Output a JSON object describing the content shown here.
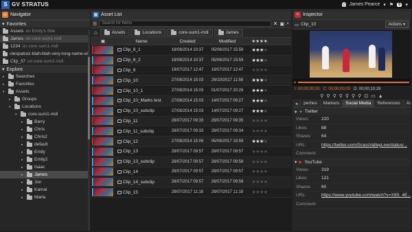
{
  "app": {
    "title": "GV STRATUS",
    "user": "James Pearce",
    "notifications": "0"
  },
  "navigator": {
    "title": "Navigator",
    "favorites_label": "Favorites",
    "favorites": [
      {
        "name": "Assets",
        "loc": " on Emily's Site"
      },
      {
        "name": "James",
        "loc": " on core-sum1-mdi"
      },
      {
        "name": "1234",
        "loc": " on core-sum1-mdi"
      },
      {
        "name": "cleopatra1-blah-blah-very-long-name-el",
        "loc": ""
      },
      {
        "name": "Clip_37",
        "loc": " on core-sum1-mdi"
      }
    ],
    "explore_label": "Explore",
    "tree": [
      {
        "label": "Searches",
        "indent": 0,
        "arrow": "▸",
        "folder": true
      },
      {
        "label": "Favorites",
        "indent": 0,
        "arrow": "▸",
        "folder": true
      },
      {
        "label": "Assets",
        "indent": 0,
        "arrow": "▾",
        "folder": true
      },
      {
        "label": "Groups",
        "indent": 1,
        "arrow": "▸",
        "folder": true
      },
      {
        "label": "Locations",
        "indent": 1,
        "arrow": "▾",
        "folder": true
      },
      {
        "label": "core-sum1-mdi",
        "indent": 2,
        "arrow": "▾",
        "folder": true
      },
      {
        "label": "Barry",
        "indent": 3,
        "arrow": "▸",
        "folder": true
      },
      {
        "label": "Chris",
        "indent": 3,
        "arrow": "▸",
        "folder": true
      },
      {
        "label": "Chris2",
        "indent": 3,
        "arrow": "▸",
        "folder": true
      },
      {
        "label": "default",
        "indent": 3,
        "arrow": "▸",
        "folder": true
      },
      {
        "label": "Emily",
        "indent": 3,
        "arrow": "▸",
        "folder": true
      },
      {
        "label": "Emily2",
        "indent": 3,
        "arrow": "▸",
        "folder": true
      },
      {
        "label": "Isaac",
        "indent": 3,
        "arrow": "▸",
        "folder": true
      },
      {
        "label": "James",
        "indent": 3,
        "arrow": "▸",
        "folder": true,
        "selected": true
      },
      {
        "label": "Jon",
        "indent": 3,
        "arrow": "▸",
        "folder": true
      },
      {
        "label": "Kamal",
        "indent": 3,
        "arrow": "▸",
        "folder": true
      },
      {
        "label": "Marla",
        "indent": 3,
        "arrow": "▸",
        "folder": true
      }
    ]
  },
  "assetlist": {
    "title": "Asset List",
    "search_placeholder": "Search for Items",
    "breadcrumb": [
      "Assets",
      "Locations",
      "core-sum1-mdi",
      "James"
    ],
    "columns": {
      "name": "Name",
      "created": "Created",
      "modified": "Modified"
    },
    "rows": [
      {
        "name": "Clip_8_1",
        "created": "18/08/2014 10:37",
        "modified": "05/06/2017 15:58",
        "stars": 3
      },
      {
        "name": "Clip_8_2",
        "created": "18/08/2014 10:37",
        "modified": "05/06/2017 15:59",
        "stars": 3
      },
      {
        "name": "Clip_9",
        "created": "19/07/2017 12:47",
        "modified": "19/07/2017 12:47",
        "stars": 0
      },
      {
        "name": "Clip_10",
        "created": "27/08/2014 15:03",
        "modified": "26/10/2017 11:58",
        "stars": 3
      },
      {
        "name": "Clip_10_1",
        "created": "27/08/2014 15:03",
        "modified": "01/07/2017 20:26",
        "stars": 3
      },
      {
        "name": "Clip_10_Marks test",
        "created": "27/08/2014 15:03",
        "modified": "14/07/2017 09:27",
        "stars": 3
      },
      {
        "name": "Clip_10_subclip",
        "created": "27/08/2014 15:03",
        "modified": "14/07/2017 09:27",
        "stars": 3
      },
      {
        "name": "Clip_11",
        "created": "28/07/2017 09:33",
        "modified": "28/07/2017 09:35",
        "stars": 0
      },
      {
        "name": "Clip_11_subclip",
        "created": "28/07/2017 09:33",
        "modified": "28/07/2017 09:34",
        "stars": 0
      },
      {
        "name": "Clip_12",
        "created": "27/08/2014 15:06",
        "modified": "05/06/2017 15:59",
        "stars": 3
      },
      {
        "name": "Clip_13",
        "created": "28/07/2017 09:57",
        "modified": "28/07/2017 09:57",
        "stars": 0
      },
      {
        "name": "Clip_13_subclip",
        "created": "28/07/2017 09:57",
        "modified": "28/07/2017 09:58",
        "stars": 0
      },
      {
        "name": "Clip_14",
        "created": "28/07/2017 09:57",
        "modified": "28/07/2017 09:57",
        "stars": 0
      },
      {
        "name": "Clip_14_subclip",
        "created": "28/07/2017 09:57",
        "modified": "28/07/2017 09:58",
        "stars": 0
      },
      {
        "name": "Clip_15",
        "created": "28/07/2017 11:18",
        "modified": "28/07/2017 11:18",
        "stars": 0
      }
    ]
  },
  "inspector": {
    "title": "Inspector",
    "clip": "Clip_10",
    "actions_label": "Actions",
    "tc_in": "I: 00;00;00;00",
    "tc_cur": "C: 00;00;00;00",
    "tc_dur": "D: 00;00;10;28",
    "tabs": [
      "perties",
      "Markers",
      "Social Media",
      "References",
      "Asse"
    ],
    "active_tab": 2,
    "twitter": {
      "label": "Twitter",
      "views_k": "Views:",
      "views": "220",
      "likes_k": "Likes:",
      "likes": "88",
      "shares_k": "Shares:",
      "shares": "64",
      "url_k": "URL:",
      "url": "https://twitter.com/GrassValleyLive/status/...",
      "comment_k": "Comment:"
    },
    "youtube": {
      "label": "YouTube",
      "views_k": "Views:",
      "views": "319",
      "likes_k": "Likes:",
      "likes": "121",
      "shares_k": "Shares:",
      "shares": "60",
      "url_k": "URL:",
      "url": "https://www.youtube.com/watch?v=X9S_4E...",
      "comment_k": "Comment:"
    }
  }
}
